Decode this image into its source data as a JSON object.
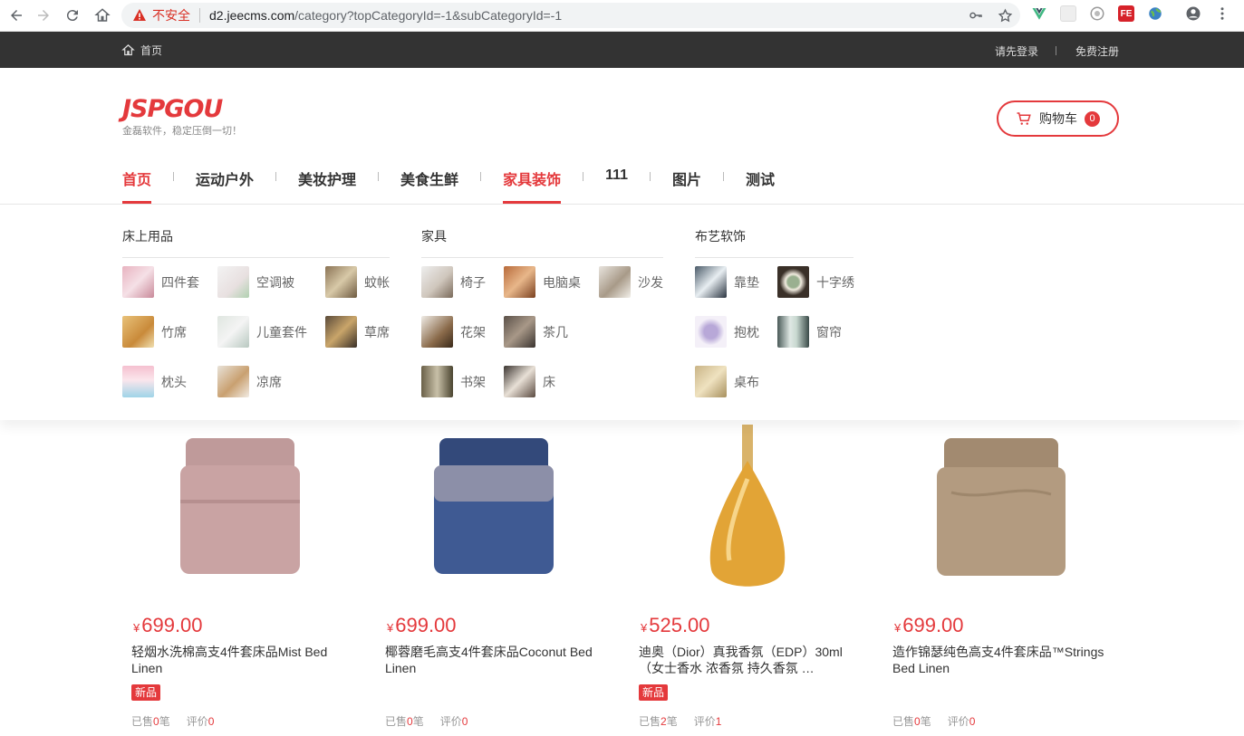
{
  "browser": {
    "insecure_label": "不安全",
    "url_host": "d2.jeecms.com",
    "url_path": "/category?topCategoryId=-1&subCategoryId=-1"
  },
  "topbar": {
    "home_label": "首页",
    "login_label": "请先登录",
    "register_label": "免费注册"
  },
  "header": {
    "brand": "JSPGOU",
    "slogan": "金磊软件，稳定压倒一切！",
    "cart_label": "购物车",
    "cart_count": "0"
  },
  "nav": {
    "items": [
      {
        "label": "首页"
      },
      {
        "label": "运动户外"
      },
      {
        "label": "美妆护理"
      },
      {
        "label": "美食生鲜"
      },
      {
        "label": "家具装饰"
      },
      {
        "label": "111"
      },
      {
        "label": "图片"
      },
      {
        "label": "测试"
      }
    ]
  },
  "mega": {
    "columns": [
      {
        "title": "床上用品",
        "items": [
          {
            "label": "四件套"
          },
          {
            "label": "空调被"
          },
          {
            "label": "蚊帐"
          },
          {
            "label": "竹席"
          },
          {
            "label": "儿童套件"
          },
          {
            "label": "草席"
          },
          {
            "label": "枕头"
          },
          {
            "label": "凉席"
          }
        ]
      },
      {
        "title": "家具",
        "items": [
          {
            "label": "椅子"
          },
          {
            "label": "电脑桌"
          },
          {
            "label": "沙发"
          },
          {
            "label": "花架"
          },
          {
            "label": "茶几"
          },
          {
            "label": "书架"
          },
          {
            "label": "床"
          }
        ]
      },
      {
        "title": "布艺软饰",
        "items": [
          {
            "label": "靠垫"
          },
          {
            "label": "十字绣"
          },
          {
            "label": "抱枕"
          },
          {
            "label": "窗帘"
          },
          {
            "label": "桌布"
          }
        ]
      }
    ]
  },
  "products": [
    {
      "currency": "¥",
      "price": "699.00",
      "name": "轻烟水洗棉高支4件套床品Mist Bed Linen",
      "tag": "新品",
      "sold_label": "已售",
      "sold": "0",
      "sold_unit": "笔",
      "review_label": "评价",
      "reviews": "0",
      "color": "#c9a3a3"
    },
    {
      "currency": "¥",
      "price": "699.00",
      "name": "椰蓉磨毛高支4件套床品Coconut Bed Linen",
      "tag": "",
      "sold_label": "已售",
      "sold": "0",
      "sold_unit": "笔",
      "review_label": "评价",
      "reviews": "0",
      "color": "#3f5a93"
    },
    {
      "currency": "¥",
      "price": "525.00",
      "name": "迪奥（Dior）真我香氛（EDP）30ml（女士香水 浓香氛 持久香氛 …",
      "tag": "新品",
      "sold_label": "已售",
      "sold": "2",
      "sold_unit": "笔",
      "review_label": "评价",
      "reviews": "1",
      "color": "#e2a436"
    },
    {
      "currency": "¥",
      "price": "699.00",
      "name": "造作锦瑟纯色高支4件套床品™Strings Bed Linen",
      "tag": "",
      "sold_label": "已售",
      "sold": "0",
      "sold_unit": "笔",
      "review_label": "评价",
      "reviews": "0",
      "color": "#b39b80"
    }
  ]
}
